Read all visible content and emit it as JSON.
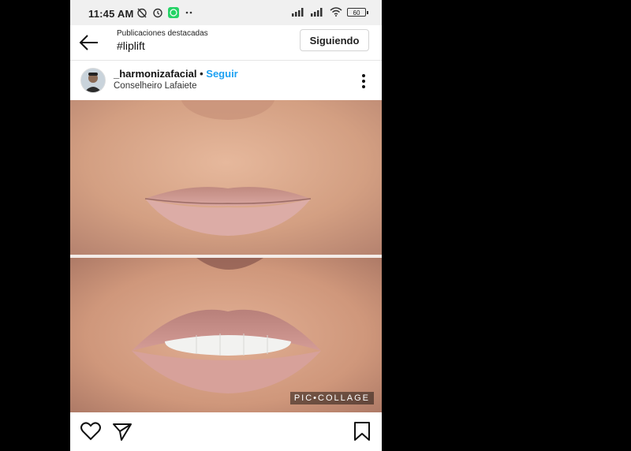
{
  "status_bar": {
    "time": "11:45 AM",
    "battery": "60"
  },
  "header": {
    "subtitle": "Publicaciones destacadas",
    "title": "#liplift",
    "follow_label": "Siguiendo"
  },
  "post": {
    "username": "_harmonizafacial",
    "separator": " • ",
    "follow_link": "Seguir",
    "location": "Conselheiro Lafaiete",
    "watermark": "PIC•COLLAGE"
  },
  "icons": {
    "back": "arrow-left-icon",
    "more": "more-vertical-icon",
    "like": "heart-icon",
    "share": "send-icon",
    "save": "bookmark-icon"
  },
  "colors": {
    "link": "#1da1f2",
    "skin": "#d9a58a",
    "lip": "#c98f86"
  }
}
